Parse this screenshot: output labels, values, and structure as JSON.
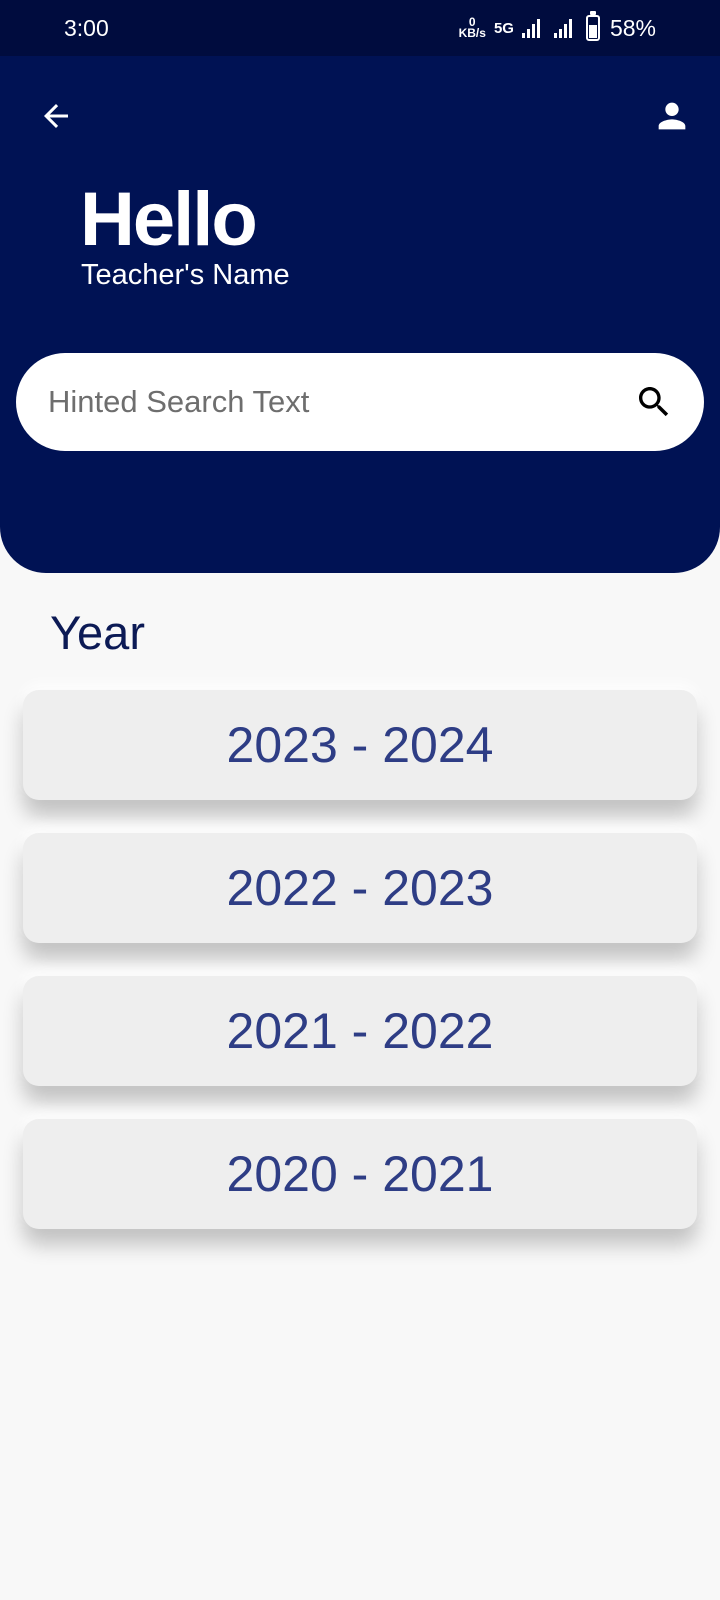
{
  "status_bar": {
    "time": "3:00",
    "net_speed_value": "0",
    "net_speed_unit": "KB/s",
    "network_type": "5G",
    "battery": "58%"
  },
  "header": {
    "greeting": "Hello",
    "teacher_name": "Teacher's Name",
    "back_icon": "arrow-left-icon",
    "profile_icon": "person-icon"
  },
  "search": {
    "placeholder": "Hinted Search Text",
    "value": "",
    "icon": "search-icon"
  },
  "section": {
    "title": "Year"
  },
  "years": [
    {
      "label": "2023 - 2024"
    },
    {
      "label": "2022 - 2023"
    },
    {
      "label": "2021 - 2022"
    },
    {
      "label": "2020 - 2021"
    }
  ],
  "colors": {
    "header_bg": "#001254",
    "status_bg": "#000c3e",
    "year_text": "#2e3d85",
    "section_title": "#0c1a55",
    "card_bg": "#eeeeee"
  }
}
